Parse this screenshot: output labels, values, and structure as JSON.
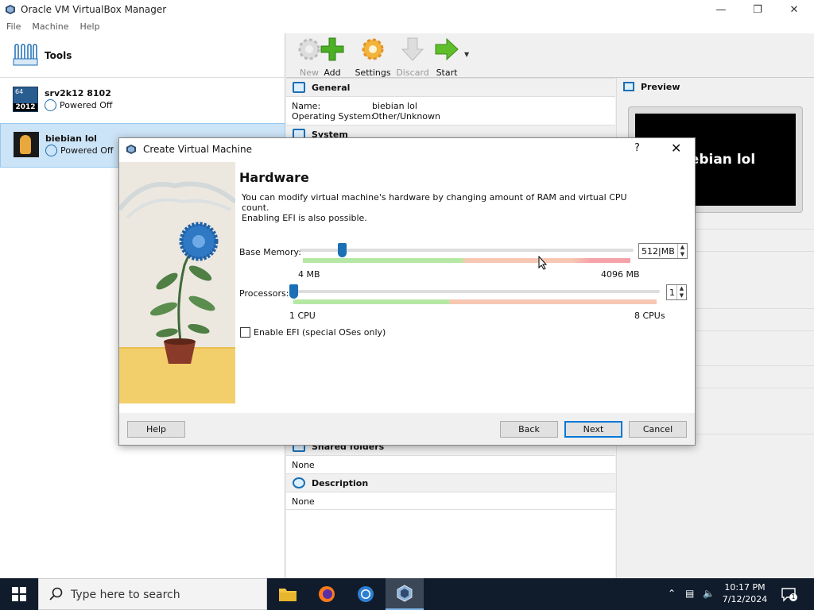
{
  "window": {
    "title": "Oracle VM VirtualBox Manager"
  },
  "menu": [
    "File",
    "Machine",
    "Help"
  ],
  "tools_label": "Tools",
  "vms": [
    {
      "name": "srv2k12 8102",
      "state": "Powered Off",
      "badge_top": "64",
      "badge_bottom": "2012"
    },
    {
      "name": "biebian lol",
      "state": "Powered Off"
    }
  ],
  "toolbar": {
    "new": "New",
    "add": "Add",
    "settings": "Settings",
    "discard": "Discard",
    "start": "Start"
  },
  "details": {
    "general_title": "General",
    "name_key": "Name:",
    "name_val": "biebian lol",
    "os_key": "Operating System:",
    "os_val": "Other/Unknown",
    "system_title": "System",
    "shared_title": "Shared folders",
    "shared_val": "None",
    "description_title": "Description",
    "description_val": "None"
  },
  "preview": {
    "title": "Preview",
    "screen_text": "biebian lol"
  },
  "dialog": {
    "title": "Create Virtual Machine",
    "help_glyph": "?",
    "heading": "Hardware",
    "desc_line1": "You can modify virtual machine's hardware by changing amount of RAM and virtual CPU count.",
    "desc_line2": "Enabling EFI is also possible.",
    "memory_label": "Base Memory:",
    "memory_min": "4 MB",
    "memory_max": "4096 MB",
    "memory_value": "512",
    "memory_unit": "MB",
    "memory_fraction": 0.125,
    "cpu_label": "Processors:",
    "cpu_min": "1 CPU",
    "cpu_max": "8 CPUs",
    "cpu_value": "1",
    "efi_label": "Enable EFI (special OSes only)",
    "efi_checked": false,
    "buttons": {
      "help": "Help",
      "back": "Back",
      "next": "Next",
      "cancel": "Cancel"
    }
  },
  "taskbar": {
    "search_placeholder": "Type here to search",
    "time": "10:17 PM",
    "date": "7/12/2024",
    "notification_count": "1"
  },
  "colors": {
    "accent": "#1b6fb5",
    "taskbar": "#101c2c",
    "selection": "#cce4f7"
  }
}
